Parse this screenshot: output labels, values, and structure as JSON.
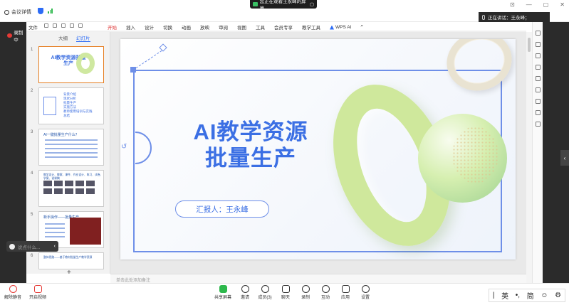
{
  "meeting": {
    "info_label": "会议详情",
    "share_banner": "您正在观看王永峰的屏幕",
    "speaking_label": "正在讲话：王永峰；"
  },
  "recording": {
    "label": "录制中"
  },
  "wps": {
    "file_menu": "文件",
    "ribbon_tabs": [
      "开始",
      "插入",
      "设计",
      "切换",
      "动画",
      "放映",
      "审阅",
      "视图",
      "工具",
      "会员专享",
      "教学工具"
    ],
    "active_tab": "开始",
    "wps_ai": "WPS AI",
    "thumb_tabs": [
      "大纲",
      "幻灯片"
    ],
    "notes_placeholder": "单击此处添加备注"
  },
  "thumbnails": [
    {
      "num": "1",
      "title": "AI教学资源批量生产"
    },
    {
      "num": "2",
      "items": [
        "背景介绍",
        "现状分析",
        "批量生产",
        "实施方法",
        "教师使用培训与实践",
        "总结"
      ]
    },
    {
      "num": "3",
      "title": "AI一键批量生产什么？"
    },
    {
      "num": "4",
      "title": "教学设计、教案、课件、作业设计、练习、试卷、学案、说课稿"
    },
    {
      "num": "5",
      "title": "新手操作——批量生产"
    },
    {
      "num": "6",
      "title": "整体思路——基于教材批量生产教学资源"
    }
  ],
  "slide": {
    "title_line1": "AI教学资源",
    "title_line2": "批量生产",
    "presenter": "汇报人：王永峰"
  },
  "chat": {
    "placeholder": "说点什么..."
  },
  "toolbar": [
    {
      "label": "解除静音"
    },
    {
      "label": "开启视频"
    },
    {
      "label": "共享屏幕"
    },
    {
      "label": "邀请"
    },
    {
      "label": "成员(3)"
    },
    {
      "label": "聊天"
    },
    {
      "label": "录制"
    },
    {
      "label": "互动"
    },
    {
      "label": "应用"
    },
    {
      "label": "设置"
    }
  ],
  "ime": {
    "lang": "英",
    "mode": "简"
  }
}
